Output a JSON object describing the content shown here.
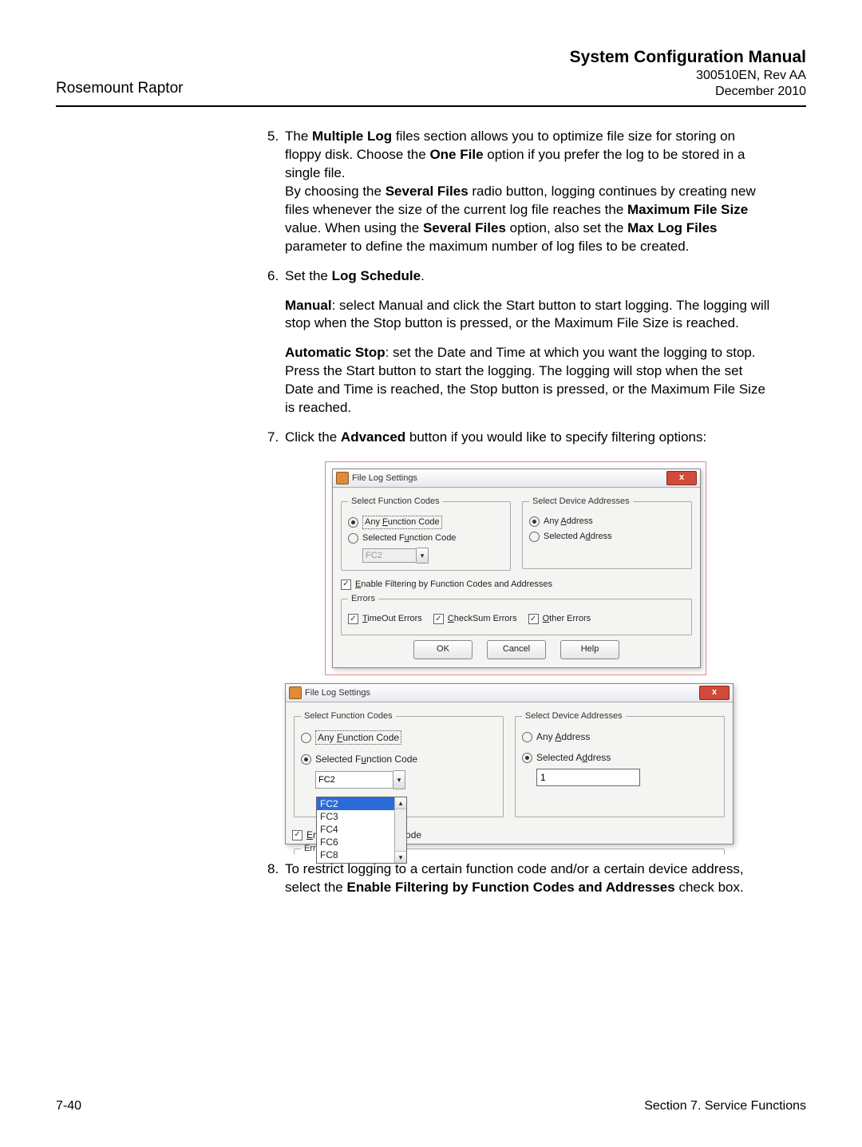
{
  "header": {
    "left": "Rosemount Raptor",
    "title": "System Configuration Manual",
    "doc": "300510EN, Rev AA",
    "date": "December 2010"
  },
  "steps": {
    "s5": {
      "num": "5.",
      "p1_a": "The ",
      "p1_b": "Multiple Log",
      "p1_c": " files section allows you to optimize file size for storing on floppy disk. Choose the ",
      "p1_d": "One File",
      "p1_e": " option if you prefer the log to be stored in a single file.",
      "p2_a": "By choosing the ",
      "p2_b": "Several Files",
      "p2_c": " radio button, logging continues by creating new files whenever the size of the current log file reaches the ",
      "p2_d": "Maximum File Size",
      "p2_e": " value. When using the ",
      "p2_f": "Several Files",
      "p2_g": " option, also set the ",
      "p2_h": "Max Log Files",
      "p2_i": " parameter to define the maximum number of log files to be created."
    },
    "s6": {
      "num": "6.",
      "p1_a": "Set the ",
      "p1_b": "Log Schedule",
      "p1_c": ".",
      "p2_a": "Manual",
      "p2_b": ": select Manual and click the Start button to start logging. The logging will stop when the Stop button is pressed, or the Maximum File Size is reached.",
      "p3_a": "Automatic Stop",
      "p3_b": ": set the Date and Time at which you want the logging to stop. Press the Start button to start the logging. The logging will stop when the set Date and Time is reached, the Stop button is pressed, or the Maximum File Size is reached."
    },
    "s7": {
      "num": "7.",
      "p1_a": "Click the ",
      "p1_b": "Advanced",
      "p1_c": " button if you would like to specify filtering options:"
    },
    "s8": {
      "num": "8.",
      "p1_a": "To restrict logging to a certain function code and/or a certain device address, select the ",
      "p1_b": "Enable Filtering by Function Codes and Addresses",
      "p1_c": " check box."
    }
  },
  "dialog1": {
    "title": "File Log Settings",
    "close": "x",
    "grp_fc": "Select Function Codes",
    "grp_da": "Select Device Addresses",
    "any_fc_pre": "Any ",
    "any_fc_u": "F",
    "any_fc_post": "unction Code",
    "sel_fc_pre": "Selected F",
    "sel_fc_u": "u",
    "sel_fc_post": "nction Code",
    "combo_fc": "FC2",
    "any_addr_pre": "Any ",
    "any_addr_u": "A",
    "any_addr_post": "ddress",
    "sel_addr_pre": "Selected A",
    "sel_addr_u": "d",
    "sel_addr_post": "dress",
    "enable_filter_u": "E",
    "enable_filter_post": "nable Filtering by Function Codes and Addresses",
    "grp_err": "Errors",
    "timeout_u": "T",
    "timeout_post": "imeOut Errors",
    "checksum_u": "C",
    "checksum_post": "heckSum Errors",
    "other_u": "O",
    "other_post": "ther Errors",
    "btn_ok": "OK",
    "btn_cancel": "Cancel",
    "btn_help": "Help"
  },
  "dialog2": {
    "title": "File Log Settings",
    "close": "x",
    "grp_fc": "Select Function Codes",
    "grp_da": "Select Device Addresses",
    "any_fc_pre": "Any ",
    "any_fc_u": "F",
    "any_fc_post": "unction Code",
    "sel_fc_pre": "Selected F",
    "sel_fc_u": "u",
    "sel_fc_post": "nction Code",
    "combo_fc": "FC2",
    "any_addr_pre": "Any ",
    "any_addr_u": "A",
    "any_addr_post": "ddress",
    "sel_addr_pre": "Selected A",
    "sel_addr_u": "d",
    "sel_addr_post": "dress",
    "addr_val": "1",
    "enable_pre_u": "E",
    "enable_pre_post": "na",
    "enable_suf": "Code",
    "grp_err": "Errors",
    "dropdown": {
      "opts": [
        "FC2",
        "FC3",
        "FC4",
        "FC6",
        "FC8"
      ]
    }
  },
  "footer": {
    "left": "7-40",
    "right": "Section 7. Service Functions"
  }
}
